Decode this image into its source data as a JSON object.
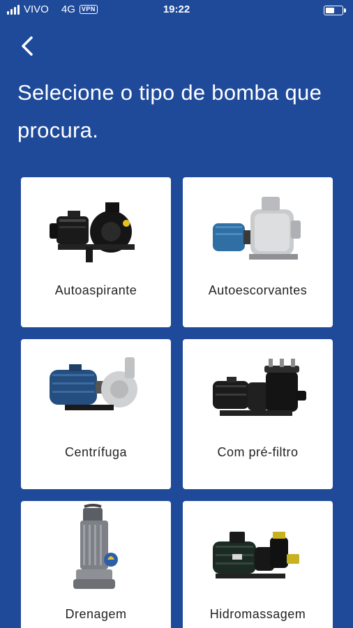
{
  "status_bar": {
    "carrier": "VIVO",
    "network": "4G",
    "vpn": "VPN",
    "time": "19:22",
    "battery_level": 0.55
  },
  "header": {
    "back_icon": "chevron-left-icon",
    "title": "Selecione o tipo de bomba que procura."
  },
  "categories": [
    {
      "label": "Autoaspirante",
      "icon": "self-priming-pump-image"
    },
    {
      "label": "Autoescorvantes",
      "icon": "self-priming-steel-pump-image"
    },
    {
      "label": "Centrífuga",
      "icon": "centrifugal-pump-image"
    },
    {
      "label": "Com pré-filtro",
      "icon": "pump-with-prefilter-image"
    },
    {
      "label": "Drenagem",
      "icon": "submersible-drainage-pump-image"
    },
    {
      "label": "Hidromassagem",
      "icon": "hydromassage-pump-image"
    }
  ],
  "colors": {
    "background": "#1f4a9a",
    "card": "#ffffff",
    "label_text": "#222222"
  }
}
